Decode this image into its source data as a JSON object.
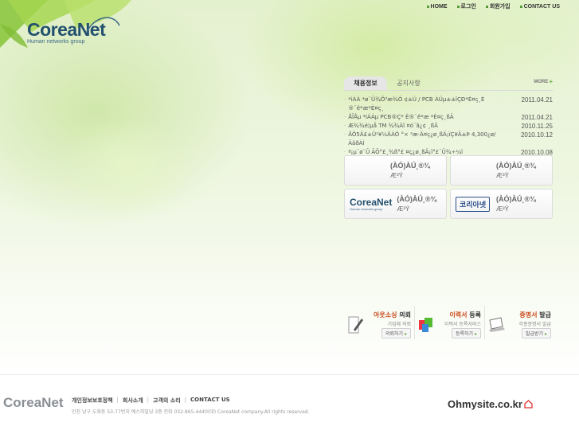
{
  "header": {
    "logo_text": "CoreaNet",
    "logo_subtitle": "Human networks group",
    "nav": [
      {
        "label": "HOME"
      },
      {
        "label": "로그인"
      },
      {
        "label": "회원가입"
      },
      {
        "label": "CONTACT US"
      }
    ]
  },
  "news": {
    "tabs": [
      {
        "label": "채용정보",
        "active": true
      },
      {
        "label": "공지사항",
        "active": false
      }
    ],
    "more_label": "MORE",
    "items": [
      {
        "title": "*iÀÀ *ø¨Û¾Ô³æ¾Ò ¢±Ù / PCB ÁÚµ±±ïÇÐ*È¤ç¸È ®¨ê*æ*È¤ç¸",
        "date": "2011.04.21"
      },
      {
        "title": "ÅÎÅµ *iÀÀµ PCB®Ç* È®¨ê*æ *È¤ç¸ßÄ",
        "date": "2011.04.21"
      },
      {
        "title": "Æ¾¾é¦µå TM ¾¾Àî ¤ó¨ã¿¢ ¸ßÄ",
        "date": "2010.11.25"
      },
      {
        "title": "ÂÖ5Ä£±Û¹¥½ÄÀÓ °× ²æ·Ä¤ç¿ø¸ßÄ¡ïÇ¥Ã±Þ 4,300¿ø/ÃäðÀÌ",
        "date": "2010.10.12"
      },
      {
        "title": "ª¡µ¨ø¨Û ÃÕ°£¸¾ß°£ ¤ç¿ø¸ßÄ¡ï°£¨Û¾÷¼ï",
        "date": "2010.10.08"
      }
    ]
  },
  "cards": [
    {
      "line1": "(ÀÓ)ÀÚ¸®¾",
      "line2": "Æ³Ý",
      "logo": ""
    },
    {
      "line1": "(ÀÓ)ÀÚ¸®¾",
      "line2": "Æ³Ý",
      "logo": ""
    },
    {
      "line1": "(ÀÓ)ÀÚ¸®¾",
      "line2": "Æ³Ý",
      "logo": "CoreaNet",
      "logo_sub": "Human networks group"
    },
    {
      "line1": "(ÀÓ)ÀÚ¸®¾",
      "line2": "Æ³Ý",
      "logo": "코리아넷"
    }
  ],
  "services": [
    {
      "title_highlight": "아웃소싱",
      "title_rest": " 의뢰",
      "sub": "기업체 의뢰",
      "button": "의뢰하기",
      "icon": "pen-icon"
    },
    {
      "title_highlight": "이력서",
      "title_rest": " 등록",
      "sub": "이력서 등록서비스",
      "button": "등록하기",
      "icon": "resume-icon"
    },
    {
      "title_highlight": "증명서",
      "title_rest": " 발급",
      "sub": "각종증명서 발급",
      "button": "발급받기",
      "icon": "laptop-icon"
    }
  ],
  "footer": {
    "logo_text": "CoreaNet",
    "links": [
      "개인정보보호정책",
      "회사소개",
      "고객의 소리",
      "CONTACT US"
    ],
    "address": "인천 남구 도화동 53-77번지 예스피빌딩 3층 전화 032-865-4440(대)  CoreaNet company.All rights reserved.",
    "partner": "Ohmysite.co.kr"
  },
  "colors": {
    "brand": "#23516e",
    "accent_green": "#6aa93d",
    "highlight": "#c94a1a"
  }
}
